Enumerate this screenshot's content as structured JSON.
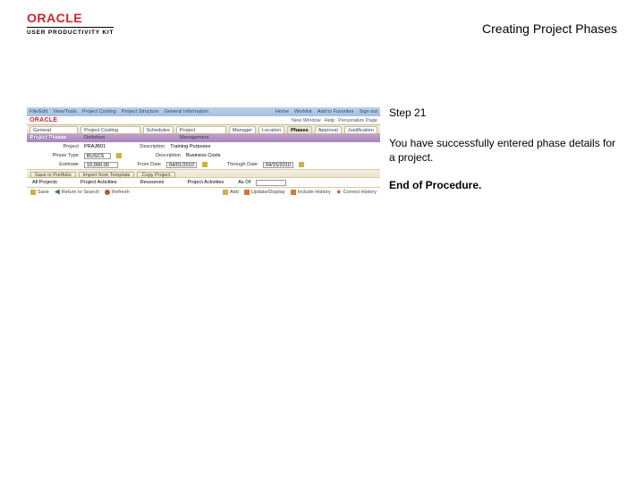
{
  "header": {
    "brand": "ORACLE",
    "subbrand": "USER PRODUCTIVITY KIT",
    "page_title": "Creating Project Phases"
  },
  "instructions": {
    "step_label": "Step 21",
    "body": "You have successfully entered phase details for a project.",
    "end": "End of Procedure."
  },
  "app": {
    "titlebar": {
      "items": [
        "File/Edit",
        "View/Tools",
        "Project Costing",
        "Project Structure",
        "General Information"
      ],
      "user": "Home",
      "worklist": "Worklist",
      "link": "Add to Favorites",
      "signout": "Sign out"
    },
    "oracle_bar": {
      "brand": "ORACLE",
      "links": [
        "New Window",
        "Help",
        "Personalize Page"
      ]
    },
    "tabs": [
      "General Information",
      "Project Costing Definition",
      "Schedules",
      "Project Management",
      "Manager",
      "Location",
      "Phases",
      "Approval",
      "Justification"
    ],
    "active_tab": 6,
    "section": "Project Phases",
    "row1": {
      "project_lbl": "Project",
      "project_val": "PRAJB01",
      "desc_lbl": "Description",
      "desc_val": "Training Purposes"
    },
    "row2": {
      "ptype_lbl": "Phase Type",
      "ptype_val": "BUSCS",
      "pdesc_lbl": "Description",
      "pdesc_val": "Business Costs"
    },
    "row3": {
      "est_lbl": "Estimate",
      "est_val": "10,000.00",
      "from_lbl": "From Date",
      "from_val": "04/01/2010",
      "thru_lbl": "Through Date",
      "thru_val": "04/15/2010"
    },
    "buttons": {
      "save": "Save in Portfolio",
      "import": "Import from Template",
      "copy": "Copy Project"
    },
    "navrow": {
      "left_lbl": "All Projects",
      "mid_lbl": "Project Activities",
      "res_lbl": "Resources",
      "pg_lbl": "Project Activities",
      "asof": "As Of"
    },
    "status": {
      "save": "Save",
      "ret": "Return to Search",
      "refresh": "Refresh",
      "add": "Add",
      "upd": "Update/Display",
      "inc": "Include History",
      "cor": "Correct History"
    }
  }
}
